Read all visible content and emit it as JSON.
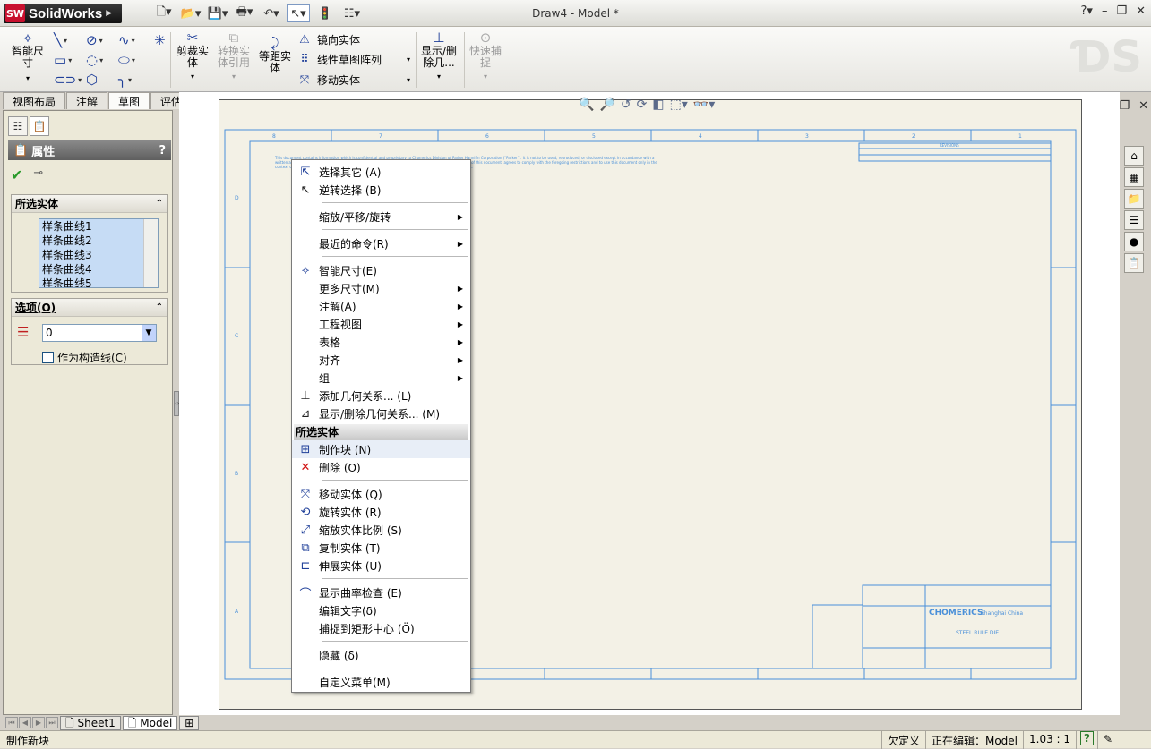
{
  "app": {
    "logo_text": "SolidWorks",
    "window_title": "Draw4 - Model *"
  },
  "toolbar": {
    "smart_dim": "智能尺寸",
    "trim": "剪裁实体",
    "convert": "转换实体引用",
    "offset": "等距实体",
    "mirror": "镜向实体",
    "linear_pattern": "线性草图阵列",
    "move": "移动实体",
    "show_relations": "显示/删除几...",
    "quick_snap": "快速捕捉"
  },
  "tabs": [
    "视图布局",
    "注解",
    "草图",
    "评估"
  ],
  "panel": {
    "title": "属性",
    "help": "?",
    "selected_group": "所选实体",
    "selected_items": [
      "样条曲线1",
      "样条曲线2",
      "样条曲线3",
      "样条曲线4",
      "样条曲线5"
    ],
    "options_group": "选项(O)",
    "layer_value": "0",
    "construction_label": "作为构造线(C)"
  },
  "context_menu": {
    "items_top": [
      {
        "label": "选择其它 (A)",
        "icon": "select-other-icon"
      },
      {
        "label": "逆转选择 (B)",
        "icon": "invert-select-icon"
      }
    ],
    "zoom": "缩放/平移/旋转",
    "recent": "最近的命令(R)",
    "group2": [
      {
        "label": "智能尺寸(E)",
        "sub": false
      },
      {
        "label": "更多尺寸(M)",
        "sub": true
      },
      {
        "label": "注解(A)",
        "sub": true
      },
      {
        "label": "工程视图",
        "sub": true
      },
      {
        "label": "表格",
        "sub": true
      },
      {
        "label": "对齐",
        "sub": true
      },
      {
        "label": "组",
        "sub": true
      },
      {
        "label": "添加几何关系... (L)",
        "sub": false
      },
      {
        "label": "显示/删除几何关系... (M)",
        "sub": false
      }
    ],
    "header": "所选实体",
    "make_block": "制作块 (N)",
    "delete": "删除 (O)",
    "group3": [
      "移动实体 (Q)",
      "旋转实体 (R)",
      "缩放实体比例 (S)",
      "复制实体 (T)",
      "伸展实体 (U)"
    ],
    "group4": [
      "显示曲率检查 (E)",
      "编辑文字(δ)",
      "捕捉到矩形中心 (Ö)"
    ],
    "hide": "隐藏 (δ)",
    "customize": "自定义菜单(M)"
  },
  "drawing": {
    "col_labels": [
      "8",
      "7",
      "6",
      "5",
      "4",
      "3",
      "2",
      "1"
    ],
    "row_labels": [
      "D",
      "C",
      "B",
      "A"
    ],
    "company": "Shanghai China",
    "drawing_title": "STEEL RULE DIE",
    "revisions": "REVISIONS",
    "notice": "This document contains information which is confidential and proprietary to Chomerics Division of Parker Hannifin Corporation (\"Parker\"). It is not to be used, reproduced, or disclosed except in accordance with a written agreement between Parker and the recipient of this document. The recipient, through its acceptance of this document, agrees to comply with the foregoing restrictions and to use this document only in the context of the applicable orders and agreements governing the relationship between Parker and the recipient."
  },
  "sheet_tabs": [
    "Sheet1",
    "Model"
  ],
  "status": {
    "message": "制作新块",
    "state": "欠定义",
    "editing": "正在编辑：Model",
    "scale": "1.03 : 1",
    "help": "?"
  }
}
